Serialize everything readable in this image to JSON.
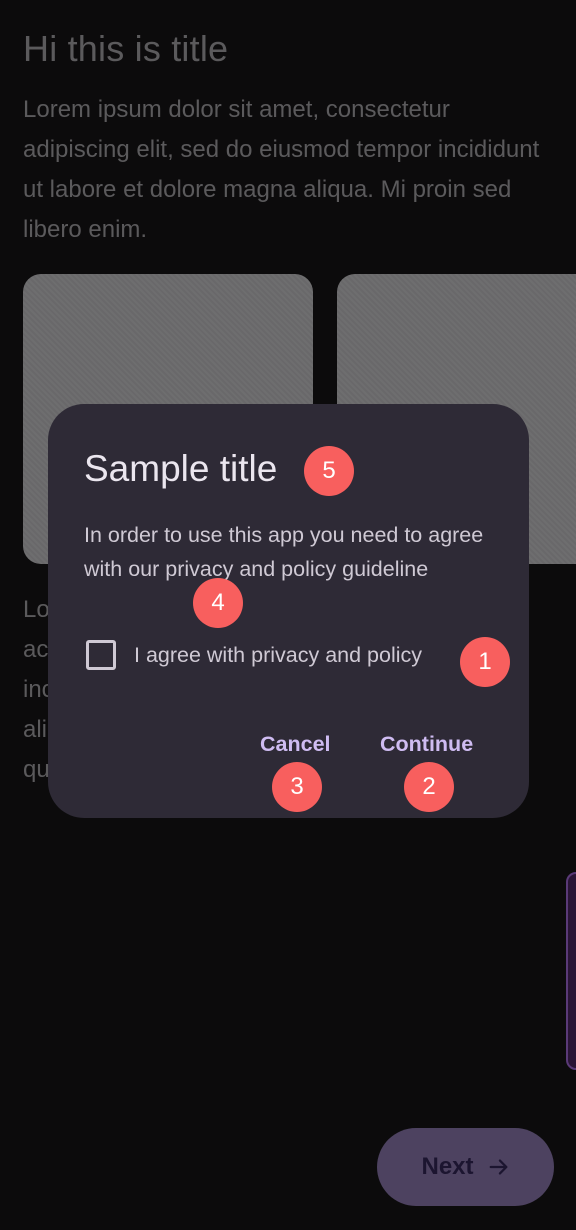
{
  "background": {
    "title": "Hi this is title",
    "paragraph": "Lorem ipsum dolor sit amet, consectetur adipiscing elit, sed do eiusmod tempor incididunt ut labore et dolore magna aliqua. Mi proin sed libero enim.",
    "paragraph_2_lines": [
      "Lo",
      "ac",
      "inc",
      "ali",
      "qu"
    ]
  },
  "fab": {
    "label": "Next",
    "icon": "arrow-right-icon"
  },
  "dialog": {
    "title": "Sample title",
    "body": "In order to use this app you need to agree with our privacy and policy guideline",
    "checkbox_label": "I agree with privacy and policy",
    "checkbox_checked": false,
    "cancel_label": "Cancel",
    "continue_label": "Continue"
  },
  "annotations": {
    "badge_1": "1",
    "badge_2": "2",
    "badge_3": "3",
    "badge_4": "4",
    "badge_5": "5"
  },
  "colors": {
    "scrim_background": "#0c0b0c",
    "dialog_surface": "#2e2a36",
    "primary_text_button": "#cfbcf2",
    "badge": "#f85f5e",
    "fab": "#4d4260"
  }
}
